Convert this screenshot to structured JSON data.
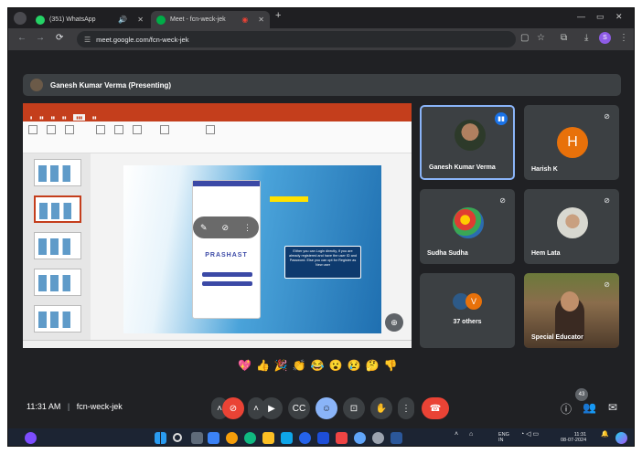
{
  "browser": {
    "tabs": [
      {
        "label": "(351) WhatsApp"
      },
      {
        "label": "Meet - fcn-weck-jek"
      }
    ],
    "url": "meet.google.com/fcn-weck-jek",
    "profile_initial": "S"
  },
  "meet": {
    "presenter_banner": "Ganesh Kumar Verma (Presenting)",
    "participants": [
      {
        "name": "Ganesh Kumar Verma",
        "speaking": true
      },
      {
        "name": "Harish K",
        "avatar_letter": "H",
        "muted": true
      },
      {
        "name": "Sudha Sudha",
        "muted": true
      },
      {
        "name": "Hem Lata",
        "muted": true
      },
      {
        "name": "37 others",
        "avatar_letter": "V"
      },
      {
        "name": "Special Educator"
      }
    ],
    "time": "11:31 AM",
    "separator": "|",
    "meeting_code": "fcn-weck-jek",
    "people_count": "43"
  },
  "slide": {
    "callout_text": "Either you can Login directly, if you are already registered and have the user ID and Password. Else you can opt for Register as New user",
    "app_name": "PRASHAST"
  },
  "reactions": [
    "💖",
    "👍",
    "🎉",
    "👏",
    "😂",
    "😮",
    "😢",
    "🤔",
    "👎"
  ],
  "taskbar": {
    "lang_line1": "ENG",
    "lang_line2": "IN",
    "clock_time": "11:31",
    "clock_date": "08-07-2024"
  }
}
